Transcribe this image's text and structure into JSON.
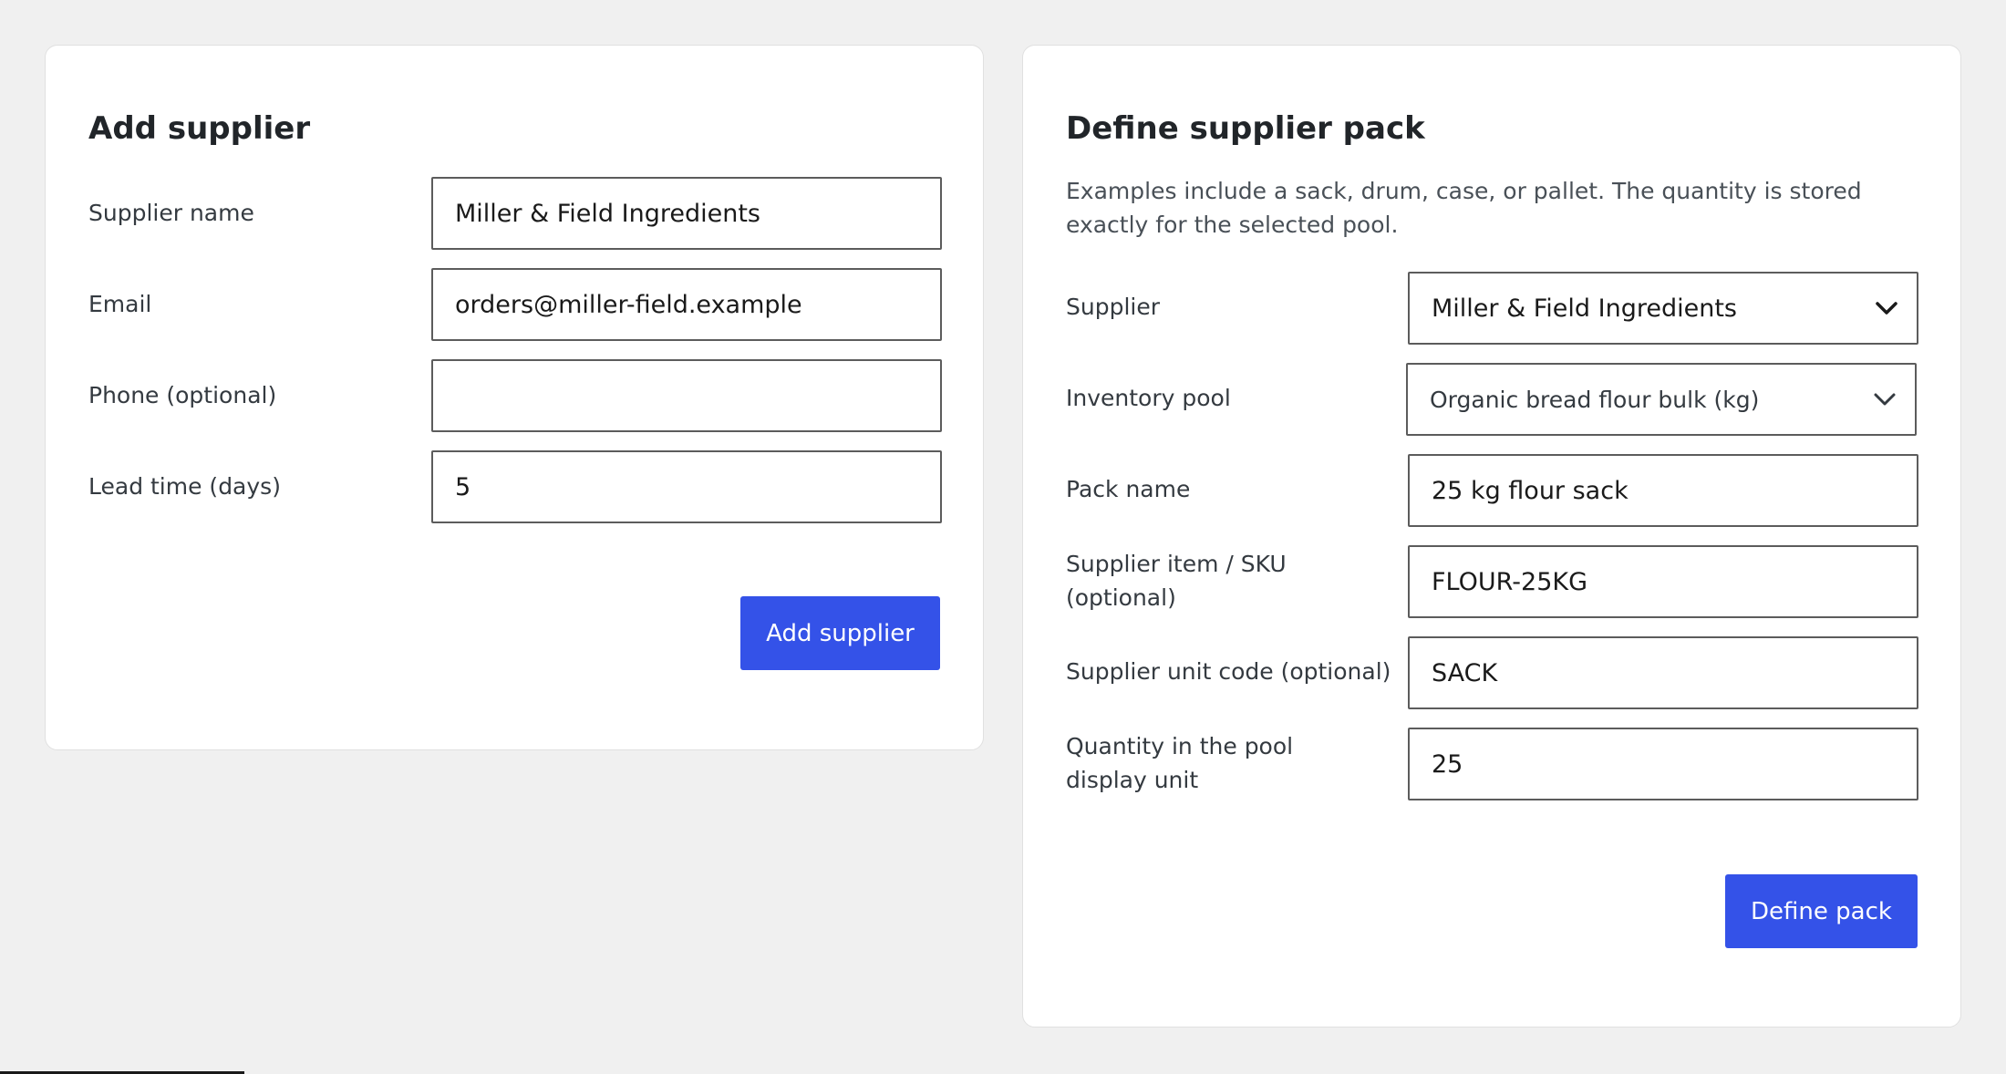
{
  "add_supplier": {
    "title": "Add supplier",
    "fields": {
      "supplier_name": {
        "label": "Supplier name",
        "value": "Miller & Field Ingredients"
      },
      "email": {
        "label": "Email",
        "value": "orders@miller-field.example"
      },
      "phone": {
        "label": "Phone (optional)",
        "value": ""
      },
      "lead_time": {
        "label": "Lead time (days)",
        "value": "5"
      }
    },
    "submit_label": "Add supplier"
  },
  "define_pack": {
    "title": "Define supplier pack",
    "description": "Examples include a sack, drum, case, or pallet. The quantity is stored exactly for the selected pool.",
    "fields": {
      "supplier": {
        "label": "Supplier",
        "selected": "Miller & Field Ingredients"
      },
      "inventory_pool": {
        "label": "Inventory pool",
        "selected": "Organic bread flour bulk (kg)"
      },
      "pack_name": {
        "label": "Pack name",
        "value": "25 kg flour sack"
      },
      "sku": {
        "label": "Supplier item / SKU (optional)",
        "value": "FLOUR-25KG"
      },
      "unit_code": {
        "label": "Supplier unit code (optional)",
        "value": "SACK"
      },
      "quantity": {
        "label": "Quantity in the pool display unit",
        "value": "25"
      }
    },
    "submit_label": "Define pack"
  },
  "colors": {
    "page_background": "#f0f0f0",
    "card_background": "#ffffff",
    "primary_button": "#3452e8",
    "input_border": "#5c5c5c"
  },
  "icons": {
    "select_chevron": "chevron-down-icon"
  }
}
